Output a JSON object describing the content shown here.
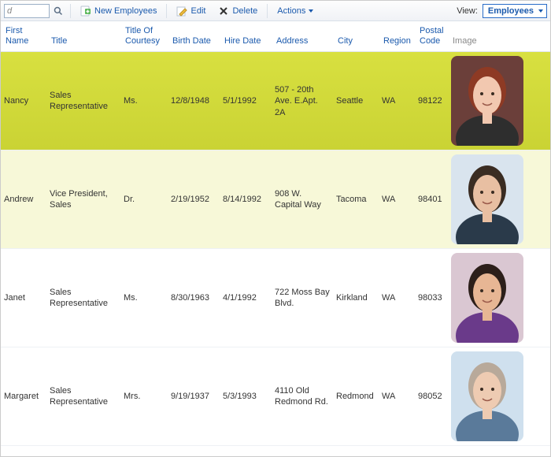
{
  "toolbar": {
    "search_placeholder": "d",
    "new_label": "New Employees",
    "edit_label": "Edit",
    "delete_label": "Delete",
    "actions_label": "Actions",
    "view_label": "View:",
    "view_selected": "Employees"
  },
  "columns": {
    "first_name": "First Name",
    "title": "Title",
    "courtesy": "Title Of Courtesy",
    "birth_date": "Birth Date",
    "hire_date": "Hire Date",
    "address": "Address",
    "city": "City",
    "region": "Region",
    "postal": "Postal Code",
    "image": "Image"
  },
  "rows": [
    {
      "first_name": "Nancy",
      "title": "Sales Representative",
      "courtesy": "Ms.",
      "birth_date": "12/8/1948",
      "hire_date": "5/1/1992",
      "address": "507 - 20th Ave. E.Apt. 2A",
      "city": "Seattle",
      "region": "WA",
      "postal": "98122",
      "selected": true,
      "avatar_bg": "#6b3f3a",
      "avatar_skin": "#f2c8b0",
      "avatar_hair": "#8e3a24",
      "avatar_cloth": "#2e2e2e"
    },
    {
      "first_name": "Andrew",
      "title": "Vice President, Sales",
      "courtesy": "Dr.",
      "birth_date": "2/19/1952",
      "hire_date": "8/14/1992",
      "address": "908 W. Capital Way",
      "city": "Tacoma",
      "region": "WA",
      "postal": "98401",
      "alt": true,
      "avatar_bg": "#d9e4ee",
      "avatar_skin": "#e8bfa2",
      "avatar_hair": "#3a2c22",
      "avatar_cloth": "#2a3a4a"
    },
    {
      "first_name": "Janet",
      "title": "Sales Representative",
      "courtesy": "Ms.",
      "birth_date": "8/30/1963",
      "hire_date": "4/1/1992",
      "address": "722 Moss Bay Blvd.",
      "city": "Kirkland",
      "region": "WA",
      "postal": "98033",
      "avatar_bg": "#dac7d2",
      "avatar_skin": "#e7b694",
      "avatar_hair": "#2c1f1a",
      "avatar_cloth": "#6a3a8a"
    },
    {
      "first_name": "Margaret",
      "title": "Sales Representative",
      "courtesy": "Mrs.",
      "birth_date": "9/19/1937",
      "hire_date": "5/3/1993",
      "address": "4110 Old Redmond Rd.",
      "city": "Redmond",
      "region": "WA",
      "postal": "98052",
      "avatar_bg": "#cfe0ee",
      "avatar_skin": "#eecbb2",
      "avatar_hair": "#b8a99a",
      "avatar_cloth": "#5a7a9a"
    }
  ]
}
